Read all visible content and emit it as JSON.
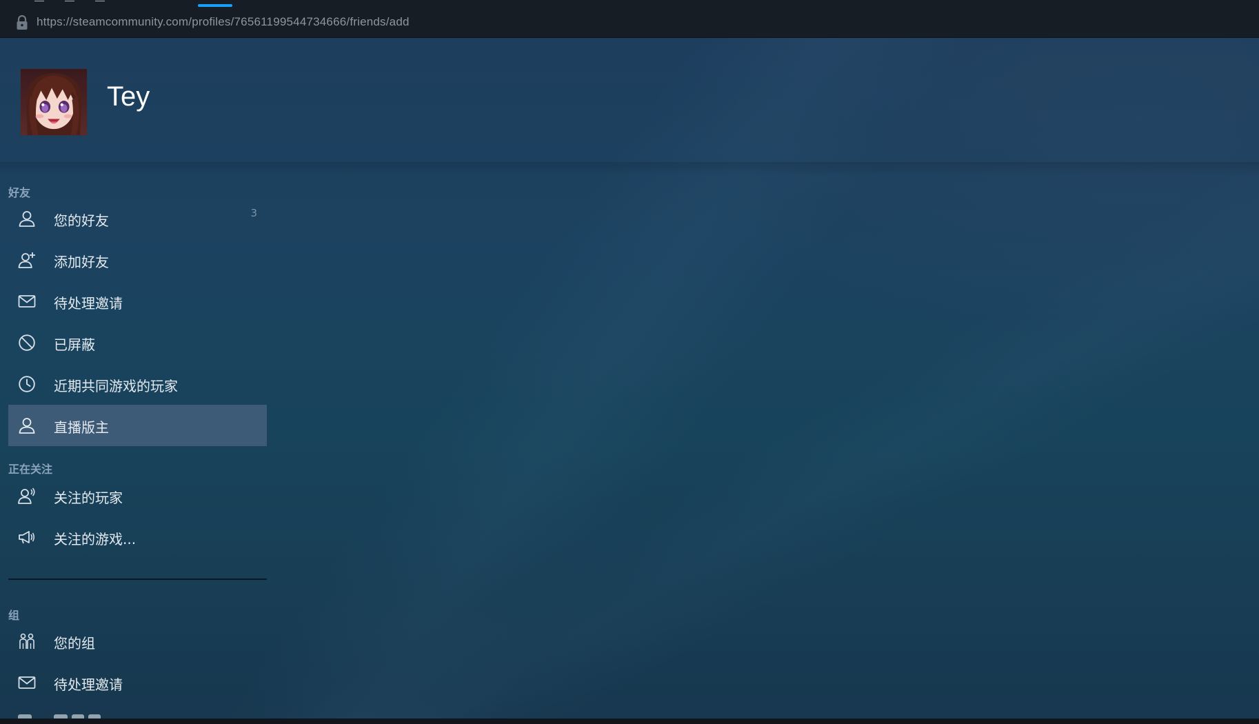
{
  "browser": {
    "url": "https://steamcommunity.com/profiles/76561199544734666/friends/add"
  },
  "profile": {
    "persona_name": "Tey"
  },
  "sidebar": {
    "friends_header": "好友",
    "friends_items": [
      {
        "label": "您的好友",
        "count": "3",
        "icon": "person-icon"
      },
      {
        "label": "添加好友",
        "icon": "add-person-icon"
      },
      {
        "label": "待处理邀请",
        "icon": "envelope-icon"
      },
      {
        "label": "已屏蔽",
        "icon": "block-icon"
      },
      {
        "label": "近期共同游戏的玩家",
        "icon": "clock-icon"
      },
      {
        "label": "直播版主",
        "icon": "person-icon",
        "active": true
      }
    ],
    "following_header": "正在关注",
    "following_items": [
      {
        "label": "关注的玩家",
        "icon": "followed-players-icon"
      },
      {
        "label": "关注的游戏...",
        "icon": "megaphone-icon"
      }
    ],
    "groups_header": "组",
    "groups_items": [
      {
        "label": "您的组",
        "icon": "group-icon"
      },
      {
        "label": "待处理邀请",
        "icon": "envelope-icon"
      }
    ]
  },
  "colors": {
    "accent": "#1a9fff",
    "active_item_bg": "#3d5a77",
    "section_header": "#8ba4bb"
  }
}
